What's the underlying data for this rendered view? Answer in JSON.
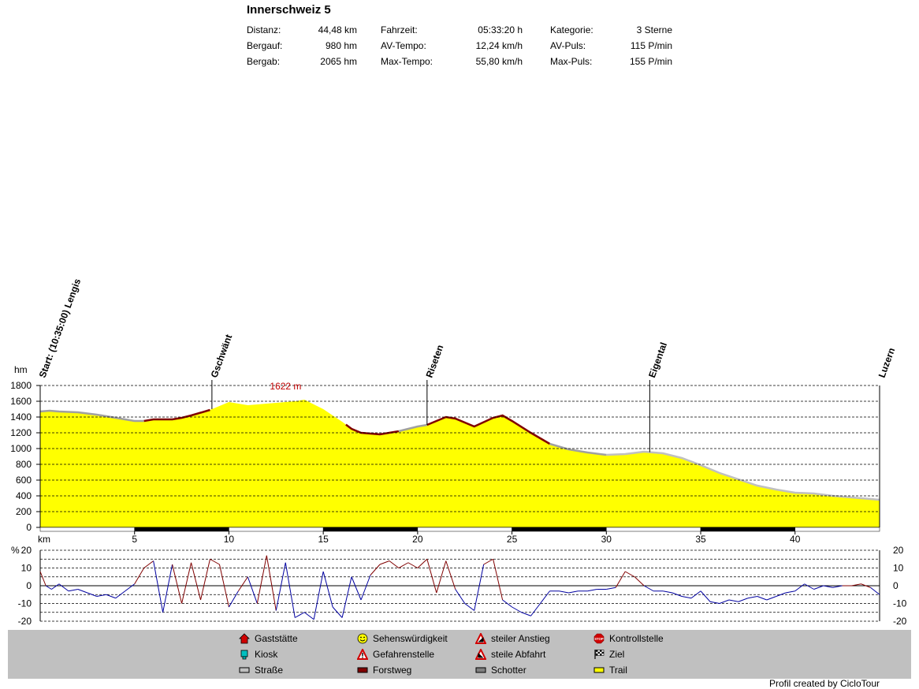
{
  "header": {
    "title": "Innerschweiz 5",
    "stats": [
      {
        "label": "Distanz:",
        "value": "44,48 km"
      },
      {
        "label": "Bergauf:",
        "value": "980 hm"
      },
      {
        "label": "Bergab:",
        "value": "2065 hm"
      },
      {
        "label": "Fahrzeit:",
        "value": "05:33:20 h"
      },
      {
        "label": "AV-Tempo:",
        "value": "12,24 km/h"
      },
      {
        "label": "Max-Tempo:",
        "value": "55,80 km/h"
      },
      {
        "label": "Kategorie:",
        "value": "3 Sterne"
      },
      {
        "label": "AV-Puls:",
        "value": "115 P/min"
      },
      {
        "label": "Max-Puls:",
        "value": "155 P/min"
      }
    ]
  },
  "chart_data": [
    {
      "type": "area",
      "ylabel": "hm",
      "xlabel": "km",
      "ylim": [
        0,
        1800
      ],
      "xlim": [
        0,
        44.48
      ],
      "yticks": [
        0,
        200,
        400,
        600,
        800,
        1000,
        1200,
        1400,
        1600,
        1800
      ],
      "xticks": [
        5,
        10,
        15,
        20,
        25,
        30,
        35,
        40
      ],
      "grid": true,
      "max_label": "1622 m",
      "max_point": {
        "x": 13.8,
        "y": 1622
      },
      "x": [
        0,
        0.5,
        1,
        2,
        3,
        4,
        5,
        5.5,
        6,
        7,
        7.5,
        8,
        9,
        9.5,
        10,
        10.5,
        11,
        12,
        13,
        13.5,
        14,
        15,
        16,
        16.5,
        17,
        18,
        19,
        20,
        20.5,
        21,
        21.5,
        22,
        23,
        24,
        24.5,
        25,
        26,
        27,
        28,
        29,
        30,
        31,
        32,
        33,
        34,
        35,
        36,
        37,
        38,
        39,
        40,
        41,
        42,
        43,
        44,
        44.48
      ],
      "y": [
        1470,
        1480,
        1470,
        1460,
        1430,
        1390,
        1350,
        1350,
        1370,
        1370,
        1390,
        1420,
        1490,
        1540,
        1590,
        1570,
        1550,
        1570,
        1590,
        1600,
        1620,
        1500,
        1340,
        1250,
        1200,
        1180,
        1220,
        1280,
        1300,
        1350,
        1400,
        1380,
        1280,
        1390,
        1420,
        1350,
        1200,
        1060,
        990,
        950,
        920,
        930,
        960,
        940,
        880,
        790,
        690,
        610,
        530,
        480,
        440,
        430,
        400,
        380,
        360,
        350
      ],
      "segments": [
        {
          "from": 0,
          "to": 5.5,
          "surface": "Schotter",
          "color": "#a0a0a0"
        },
        {
          "from": 5.5,
          "to": 9,
          "surface": "Forstweg",
          "color": "#800000"
        },
        {
          "from": 9,
          "to": 16.2,
          "surface": "Trail",
          "color": "#ffff00"
        },
        {
          "from": 16.2,
          "to": 19,
          "surface": "Forstweg",
          "color": "#800000"
        },
        {
          "from": 19,
          "to": 20.5,
          "surface": "Schotter",
          "color": "#a0a0a0"
        },
        {
          "from": 20.5,
          "to": 27,
          "surface": "Forstweg",
          "color": "#800000"
        },
        {
          "from": 27,
          "to": 30,
          "surface": "Schotter",
          "color": "#a0a0a0"
        },
        {
          "from": 30,
          "to": 44.48,
          "surface": "Straße",
          "color": "#c0c0c0"
        }
      ],
      "waypoints": [
        {
          "name": "Start: (10:35:00) Lengis",
          "x": 0
        },
        {
          "name": "Gschwänt",
          "x": 9.1
        },
        {
          "name": "Riseten",
          "x": 20.5
        },
        {
          "name": "Eigental",
          "x": 32.3
        },
        {
          "name": "Luzern",
          "x": 44.48
        }
      ]
    },
    {
      "type": "line",
      "ylabel": "%",
      "ylim": [
        -20,
        20
      ],
      "yticks": [
        -20,
        -15,
        -10,
        -5,
        0,
        5,
        10,
        15,
        20
      ],
      "ytick_labels": [
        "-20",
        "-10",
        "0",
        "10",
        "20"
      ],
      "grid": true,
      "x": [
        0,
        0.3,
        0.6,
        1,
        1.5,
        2,
        2.5,
        3,
        3.5,
        4,
        4.5,
        5,
        5.5,
        6,
        6.5,
        7,
        7.5,
        8,
        8.5,
        9,
        9.5,
        10,
        10.5,
        11,
        11.5,
        12,
        12.5,
        13,
        13.5,
        14,
        14.5,
        15,
        15.5,
        16,
        16.5,
        17,
        17.5,
        18,
        18.5,
        19,
        19.5,
        20,
        20.5,
        21,
        21.5,
        22,
        22.5,
        23,
        23.5,
        24,
        24.5,
        25,
        25.5,
        26,
        26.5,
        27,
        27.5,
        28,
        28.5,
        29,
        29.5,
        30,
        30.5,
        31,
        31.5,
        32,
        32.5,
        33,
        33.5,
        34,
        34.5,
        35,
        35.5,
        36,
        36.5,
        37,
        37.5,
        38,
        38.5,
        39,
        39.5,
        40,
        40.5,
        41,
        41.5,
        42,
        42.5,
        43,
        43.5,
        44,
        44.48
      ],
      "y": [
        8,
        0,
        -2,
        1,
        -3,
        -2,
        -4,
        -6,
        -5,
        -7,
        -3,
        1,
        10,
        14,
        -15,
        12,
        -10,
        13,
        -8,
        15,
        12,
        -12,
        -3,
        5,
        -10,
        17,
        -14,
        13,
        -18,
        -15,
        -19,
        8,
        -12,
        -18,
        5,
        -8,
        6,
        12,
        14,
        10,
        13,
        10,
        15,
        -4,
        14,
        -2,
        -10,
        -14,
        12,
        15,
        -8,
        -12,
        -15,
        -17,
        -10,
        -3,
        -3,
        -4,
        -3,
        -3,
        -2,
        -2,
        -1,
        8,
        5,
        0,
        -3,
        -3,
        -4,
        -6,
        -7,
        -3,
        -9,
        -10,
        -8,
        -9,
        -7,
        -6,
        -8,
        -6,
        -4,
        -3,
        1,
        -2,
        0,
        -1,
        0,
        0,
        1,
        -1,
        -5
      ]
    }
  ],
  "legend": [
    {
      "label": "Gaststätte",
      "icon": "house-icon"
    },
    {
      "label": "Kiosk",
      "icon": "kiosk-icon"
    },
    {
      "label": "Straße",
      "icon": "road-swatch",
      "color": "#c0c0c0"
    },
    {
      "label": "Sehenswürdigkeit",
      "icon": "smiley-icon"
    },
    {
      "label": "Gefahrenstelle",
      "icon": "warning-icon"
    },
    {
      "label": "Forstweg",
      "icon": "forest-road-swatch",
      "color": "#800000"
    },
    {
      "label": "steiler Anstieg",
      "icon": "steep-climb-icon"
    },
    {
      "label": "steile Abfahrt",
      "icon": "steep-descent-icon"
    },
    {
      "label": "Schotter",
      "icon": "gravel-swatch",
      "color": "#808080"
    },
    {
      "label": "Kontrollstelle",
      "icon": "stop-icon"
    },
    {
      "label": "Ziel",
      "icon": "finish-flag-icon"
    },
    {
      "label": "Trail",
      "icon": "trail-swatch",
      "color": "#ffff00"
    }
  ],
  "credit": "Profil created by CicloTour"
}
